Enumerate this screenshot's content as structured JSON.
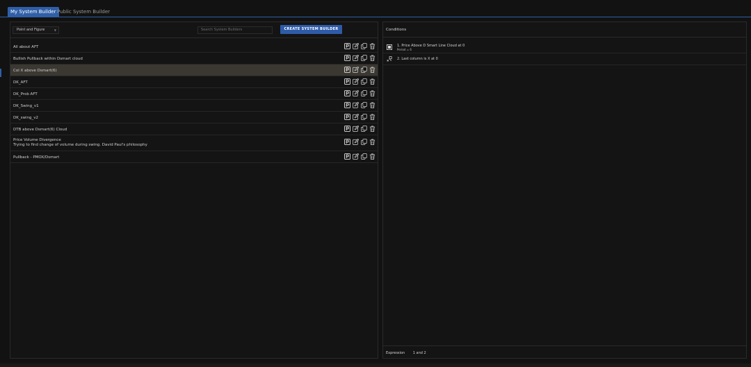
{
  "tabs": [
    {
      "label": "My System Builder",
      "active": true
    },
    {
      "label": "Public System Builder",
      "active": false
    }
  ],
  "toolbar": {
    "chart_type": "Point and Figure",
    "search_placeholder": "Search System Builders",
    "create_label": "CREATE SYSTEM BUILDER"
  },
  "systems": [
    {
      "name": "All about AFT",
      "description": "",
      "selected": false
    },
    {
      "name": "Bullish Pullback within Dsmart cloud",
      "description": "",
      "selected": false
    },
    {
      "name": "Col X above Dsmart(6)",
      "description": "",
      "selected": true
    },
    {
      "name": "DK_AFT",
      "description": "",
      "selected": false
    },
    {
      "name": "DK_Prob AFT",
      "description": "",
      "selected": false
    },
    {
      "name": "DK_Swing_v1",
      "description": "",
      "selected": false
    },
    {
      "name": "DK_swing_v2",
      "description": "",
      "selected": false
    },
    {
      "name": "DTB above Dsmart(6) Cloud",
      "description": "",
      "selected": false
    },
    {
      "name": "Price Volume Divergence",
      "description": "Trying to find change of volume during swing. David Paul's philosophy",
      "selected": false
    },
    {
      "name": "Pullback - PMOX/Dsmart",
      "description": "",
      "selected": false
    }
  ],
  "row_actions": [
    "p-badge-icon",
    "edit-icon",
    "copy-icon",
    "trash-icon"
  ],
  "conditions": {
    "title": "Conditions",
    "items": [
      {
        "label": "1. Price Above D Smart Line Cloud at 0",
        "sub": "Period = 6",
        "icon": "cloud-indicator-icon"
      },
      {
        "label": "2. Last column is X at 0",
        "sub": "",
        "icon": "pnf-column-icon"
      }
    ]
  },
  "expression": {
    "label": "Expression",
    "value": "1 and 2"
  },
  "colors": {
    "accent": "#2f5fa8",
    "selected_row": "#3b3832",
    "background": "#121212"
  }
}
